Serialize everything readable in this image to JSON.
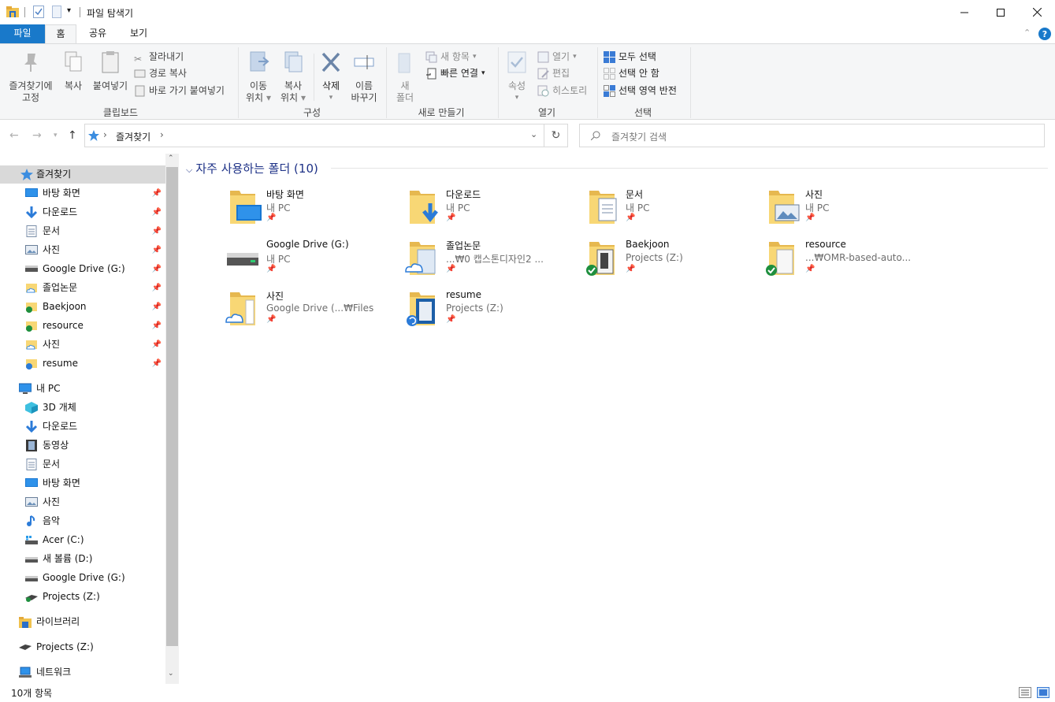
{
  "window": {
    "title": "파일 탐색기"
  },
  "tabs": [
    "파일",
    "홈",
    "공유",
    "보기"
  ],
  "ribbon": {
    "clipboard": {
      "label": "클립보드",
      "pin_label_1": "즐겨찾기에",
      "pin_label_2": "고정",
      "copy": "복사",
      "paste": "붙여넣기",
      "cut": "잘라내기",
      "copy_path": "경로 복사",
      "paste_shortcut": "바로 가기 붙여넣기"
    },
    "organize": {
      "label": "구성",
      "move_1": "이동",
      "move_2": "위치",
      "copy_1": "복사",
      "copy_2": "위치",
      "delete": "삭제",
      "rename_1": "이름",
      "rename_2": "바꾸기"
    },
    "new": {
      "label": "새로 만들기",
      "folder_1": "새",
      "folder_2": "폴더",
      "new_item": "새 항목",
      "easy_access": "빠른 연결"
    },
    "open": {
      "label": "열기",
      "properties": "속성",
      "open": "열기",
      "edit": "편집",
      "history": "히스토리"
    },
    "select": {
      "label": "선택",
      "select_all": "모두 선택",
      "select_none": "선택 안 함",
      "invert": "선택 영역 반전"
    }
  },
  "address": {
    "crumb": "즐겨찾기",
    "search_placeholder": "즐겨찾기 검색"
  },
  "nav": {
    "quick_access": "즐겨찾기",
    "quick_items": [
      "바탕 화면",
      "다운로드",
      "문서",
      "사진",
      "Google Drive (G:)",
      "졸업논문",
      "Baekjoon",
      "resource",
      "사진",
      "resume"
    ],
    "this_pc": "내 PC",
    "pc_items": [
      "3D 개체",
      "다운로드",
      "동영상",
      "문서",
      "바탕 화면",
      "사진",
      "음악",
      "Acer (C:)",
      "새 볼륨 (D:)",
      "Google Drive (G:)",
      "Projects (Z:)"
    ],
    "libraries": "라이브러리",
    "projects": "Projects (Z:)",
    "network": "네트워크"
  },
  "content": {
    "section_title": "자주 사용하는 폴더 (10)",
    "tiles": [
      {
        "name": "바탕 화면",
        "sub": "내 PC"
      },
      {
        "name": "다운로드",
        "sub": "내 PC"
      },
      {
        "name": "문서",
        "sub": "내 PC"
      },
      {
        "name": "사진",
        "sub": "내 PC"
      },
      {
        "name": "Google Drive (G:)",
        "sub": "내 PC"
      },
      {
        "name": "졸업논문",
        "sub": "...₩0 캡스톤디자인2 ..."
      },
      {
        "name": "Baekjoon",
        "sub": "Projects (Z:)"
      },
      {
        "name": "resource",
        "sub": "...₩OMR-based-auto..."
      },
      {
        "name": "사진",
        "sub": "Google Drive (...₩Files"
      },
      {
        "name": "resume",
        "sub": "Projects (Z:)"
      }
    ]
  },
  "status": {
    "count": "10개 항목"
  },
  "colors": {
    "accent": "#1979ca",
    "folder": "#f8d775",
    "folder_dark": "#e6b84f",
    "selected": "#d9d9d9",
    "header": "#1e3287"
  }
}
